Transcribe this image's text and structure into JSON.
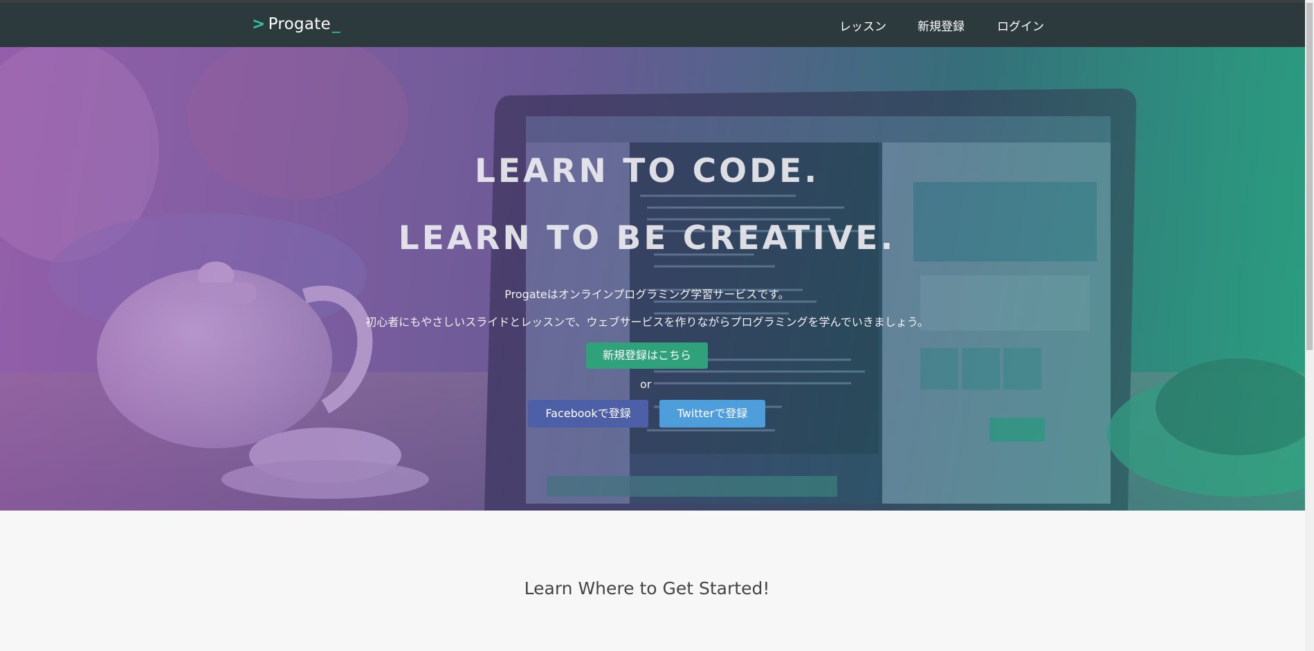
{
  "header": {
    "logo_prefix": ">",
    "logo_text": "Progate",
    "logo_suffix": "_",
    "nav": {
      "lessons": "レッスン",
      "signup": "新規登録",
      "login": "ログイン"
    }
  },
  "hero": {
    "title_line1": "LEARN TO CODE.",
    "title_line2": "LEARN TO BE CREATIVE.",
    "subtitle_line1": "Progateはオンラインプログラミング学習サービスです。",
    "subtitle_line2": "初心者にもやさしいスライドとレッスンで、ウェブサービスを作りながらプログラミングを学んでいきましょう。",
    "signup_button": "新規登録はこちら",
    "or_text": "or",
    "facebook_button": "Facebookで登録",
    "twitter_button": "Twitterで登録"
  },
  "section": {
    "title": "Learn Where to Get Started!"
  },
  "colors": {
    "header_bg": "#2c3a3d",
    "brand_accent": "#2ec4a3",
    "signup_green": "#2fa27c",
    "facebook_blue": "#4d5fa6",
    "twitter_blue": "#4f9edc"
  }
}
